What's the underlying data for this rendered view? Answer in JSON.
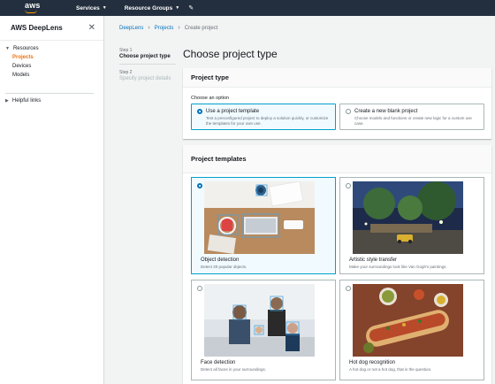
{
  "topnav": {
    "logo": "aws",
    "services": "Services",
    "resource_groups": "Resource Groups",
    "pin": "✎"
  },
  "sidebar": {
    "title": "AWS DeepLens",
    "close": "✕",
    "group1": "Resources",
    "items": [
      "Projects",
      "Devices",
      "Models"
    ],
    "group2": "Helpful links"
  },
  "breadcrumb": {
    "root": "DeepLens",
    "parent": "Projects",
    "current": "Create project",
    "sep": "›"
  },
  "steps": [
    {
      "num": "Step 1",
      "label": "Choose project type"
    },
    {
      "num": "Step 2",
      "label": "Specify project details"
    }
  ],
  "page_title": "Choose project type",
  "project_type": {
    "heading": "Project type",
    "choose_label": "Choose an option",
    "options": [
      {
        "title": "Use a project template",
        "desc": "Test a preconfigured project to deploy a solution quickly, or customize the templates for your own use."
      },
      {
        "title": "Create a new blank project",
        "desc": "Choose models and functions or create new logic for a custom use case."
      }
    ]
  },
  "templates": {
    "heading": "Project templates",
    "cards": [
      {
        "title": "Object detection",
        "desc": "Detect 20 popular objects."
      },
      {
        "title": "Artistic style transfer",
        "desc": "Make your surroundings look like Van Gogh's paintings."
      },
      {
        "title": "Face detection",
        "desc": "Detect all faces in your surroundings."
      },
      {
        "title": "Hot dog recognition",
        "desc": "A hot dog or not a hot dog, that is the question."
      }
    ]
  }
}
